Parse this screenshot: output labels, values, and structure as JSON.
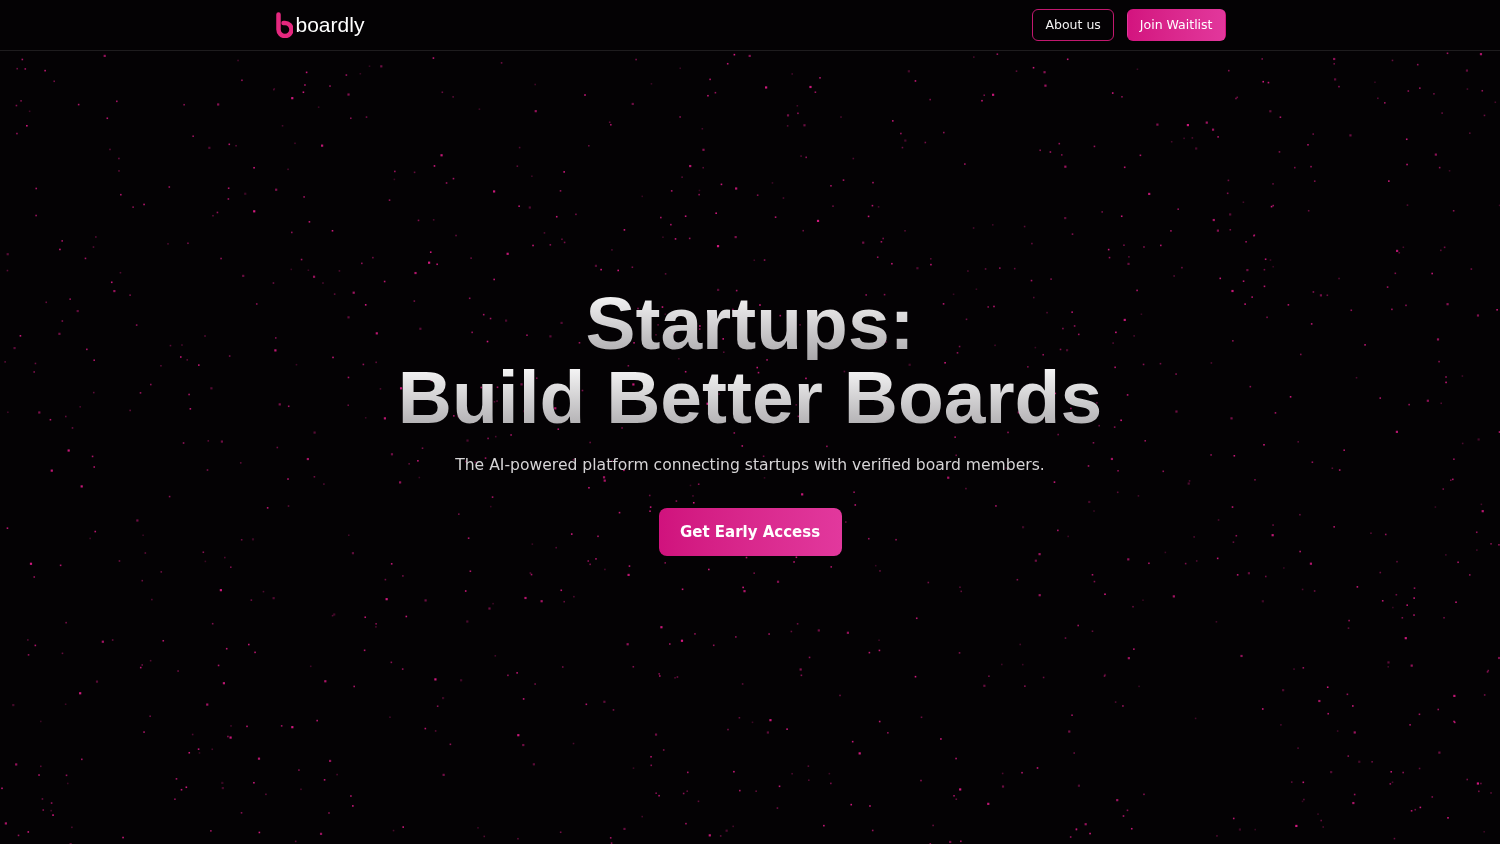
{
  "header": {
    "logo": {
      "wordmark": "boardly"
    },
    "nav_buttons": [
      {
        "label": "About us",
        "kind": "outline"
      },
      {
        "label": "Join Waitlist",
        "kind": "filled"
      }
    ]
  },
  "hero": {
    "heading_lines": [
      "Startups:",
      "Build Better Boards"
    ],
    "subtitle": "The AI-powered platform connecting startups with verified board members.",
    "cta_button": "Get Early Access"
  }
}
